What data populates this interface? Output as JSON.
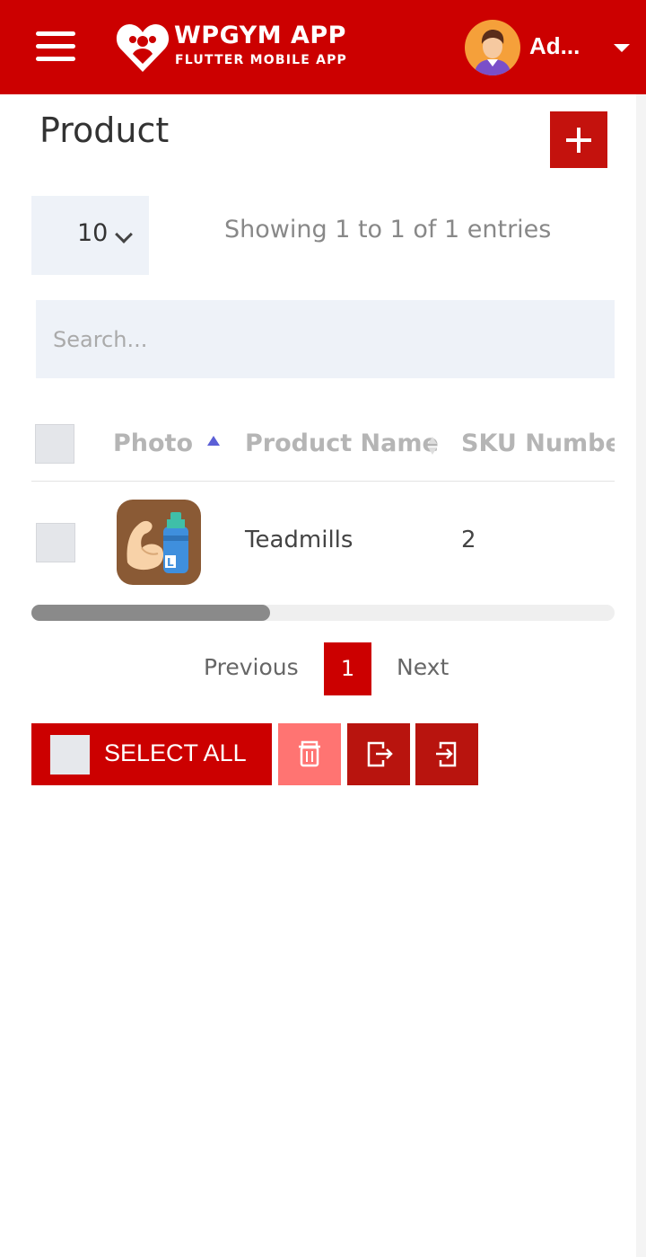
{
  "header": {
    "brand_title": "WPGYM APP",
    "brand_subtitle": "FLUTTER MOBILE APP",
    "user_name": "Ad...",
    "brand_color": "#cc0000"
  },
  "page": {
    "title": "Product"
  },
  "controls": {
    "page_length": "10",
    "info": "Showing 1 to 1 of 1 entries",
    "search_placeholder": "Search..."
  },
  "table": {
    "columns": [
      "Photo",
      "Product Name",
      "SKU Number"
    ],
    "rows": [
      {
        "photo_icon": "muscle-bottle-icon",
        "product_name": "Teadmills",
        "sku_number": "2"
      }
    ]
  },
  "pagination": {
    "previous": "Previous",
    "current": "1",
    "next": "Next"
  },
  "actions": {
    "select_all": "SELECT ALL",
    "delete_icon": "trash-icon",
    "export_icon": "file-export-icon",
    "import_icon": "file-import-icon"
  }
}
